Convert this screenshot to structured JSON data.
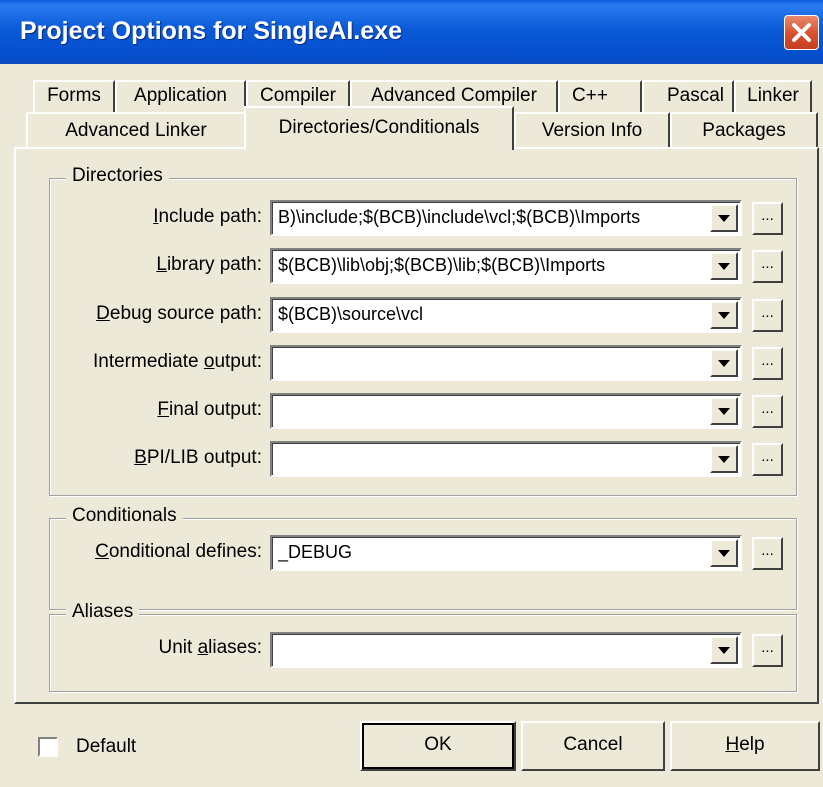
{
  "window": {
    "title": "Project Options for SingleAI.exe"
  },
  "tabs": {
    "row1": [
      "Forms",
      "Application",
      "Compiler",
      "Advanced Compiler",
      "C++",
      "Pascal",
      "Linker"
    ],
    "row2": [
      "Advanced Linker",
      "Directories/Conditionals",
      "Version Info",
      "Packages"
    ],
    "active": "Directories/Conditionals"
  },
  "directories": {
    "title": "Directories",
    "fields": [
      {
        "key": "I",
        "label_rest": "nclude path:",
        "value": "B)\\include;$(BCB)\\include\\vcl;$(BCB)\\Imports"
      },
      {
        "key": "L",
        "label_rest": "ibrary path:",
        "value": "$(BCB)\\lib\\obj;$(BCB)\\lib;$(BCB)\\Imports"
      },
      {
        "key": "D",
        "label_rest": "ebug source path:",
        "value": "$(BCB)\\source\\vcl"
      },
      {
        "label_pre": "Intermediate ",
        "key": "o",
        "label_rest": "utput:",
        "value": ""
      },
      {
        "key": "F",
        "label_rest": "inal output:",
        "value": ""
      },
      {
        "key": "B",
        "label_rest": "PI/LIB output:",
        "value": ""
      }
    ]
  },
  "conditionals": {
    "title": "Conditionals",
    "key": "C",
    "label_rest": "onditional defines:",
    "value": "_DEBUG"
  },
  "aliases": {
    "title": "Aliases",
    "label_pre": "Unit ",
    "key": "a",
    "label_rest": "liases:",
    "value": ""
  },
  "ellipsis": "...",
  "footer": {
    "default_label": "Default",
    "ok_label": "OK",
    "cancel_label": "Cancel",
    "help_key": "H",
    "help_rest": "elp"
  }
}
